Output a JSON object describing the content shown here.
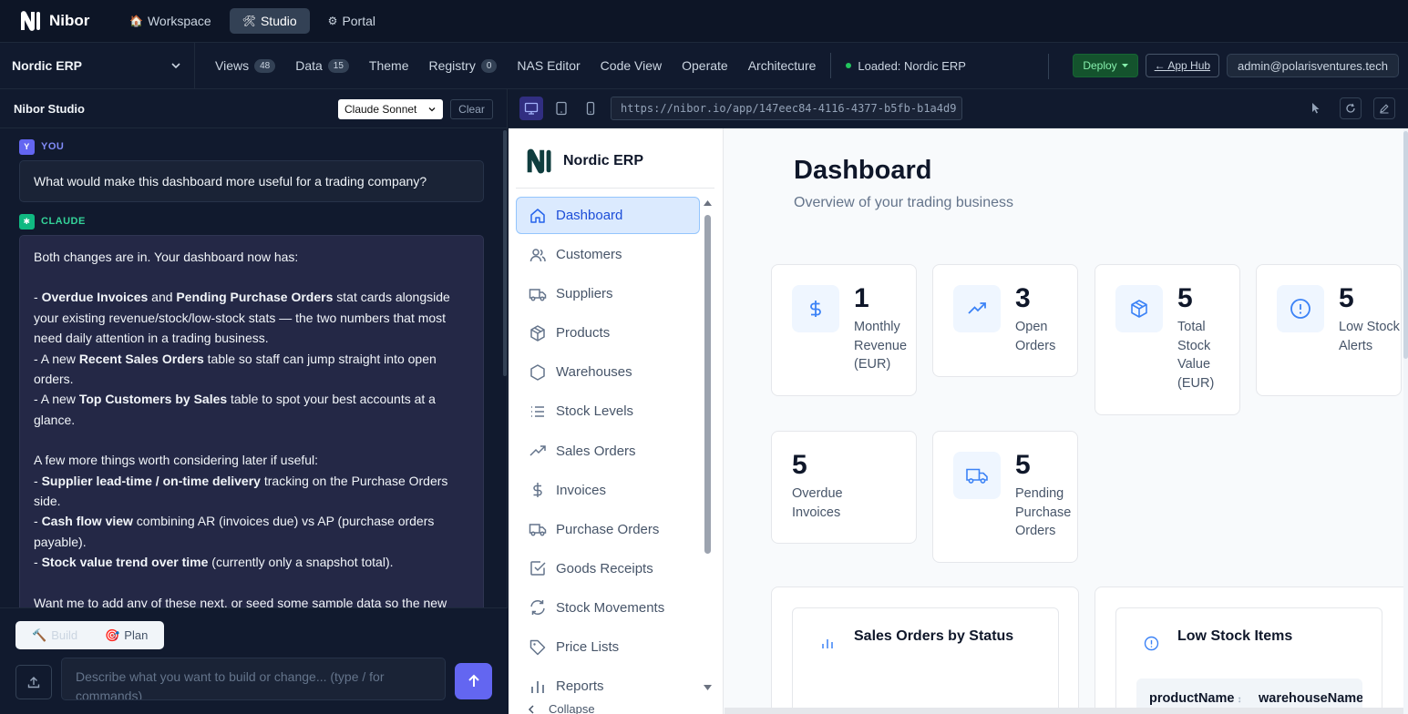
{
  "topbar": {
    "brand": "Nibor",
    "nav": [
      {
        "label": "Workspace",
        "emoji": "🏠"
      },
      {
        "label": "Studio",
        "emoji": "🛠"
      },
      {
        "label": "Portal",
        "emoji": "⚙"
      }
    ]
  },
  "subbar": {
    "project": "Nordic ERP",
    "tabs": [
      {
        "label": "Views",
        "badge": "48"
      },
      {
        "label": "Data",
        "badge": "15"
      },
      {
        "label": "Theme",
        "badge": ""
      },
      {
        "label": "Registry",
        "badge": "0"
      },
      {
        "label": "NAS Editor",
        "badge": ""
      },
      {
        "label": "Code View",
        "badge": ""
      },
      {
        "label": "Operate",
        "badge": ""
      },
      {
        "label": "Architecture",
        "badge": ""
      }
    ],
    "loaded": "Loaded: Nordic ERP",
    "deploy": "Deploy",
    "apphub": "← App Hub",
    "user": "admin@polarisventures.tech"
  },
  "chat": {
    "title": "Nibor Studio",
    "model": "Claude Sonnet",
    "clear": "Clear",
    "you_label": "YOU",
    "you_avatar": "Y",
    "claude_label": "CLAUDE",
    "claude_avatar": "✱",
    "user_message": "What would make this dashboard more useful for a trading company?",
    "ai": {
      "intro": "Both changes are in. Your dashboard now has:",
      "b1_pre": "- ",
      "b1_bold1": "Overdue Invoices",
      "b1_mid": " and ",
      "b1_bold2": "Pending Purchase Orders",
      "b1_post": " stat cards alongside your existing revenue/stock/low-stock stats — the two numbers that most need daily attention in a trading business.",
      "b2_pre": "- A new ",
      "b2_bold": "Recent Sales Orders",
      "b2_post": " table so staff can jump straight into open orders.",
      "b3_pre": "- A new ",
      "b3_bold": "Top Customers by Sales",
      "b3_post": " table to spot your best accounts at a glance.",
      "later": "A few more things worth considering later if useful:",
      "c1_pre": "- ",
      "c1_bold": "Supplier lead-time / on-time delivery",
      "c1_post": " tracking on the Purchase Orders side.",
      "c2_pre": "- ",
      "c2_bold": "Cash flow view",
      "c2_post": " combining AR (invoices due) vs AP (purchase orders payable).",
      "c3_pre": "- ",
      "c3_bold": "Stock value trend over time",
      "c3_post": " (currently only a snapshot total).",
      "closing": "Want me to add any of these next, or seed some sample data so the new"
    },
    "mode_build": "Build",
    "mode_build_emoji": "🔨",
    "mode_plan": "Plan",
    "mode_plan_emoji": "🎯",
    "prompt_placeholder": "Describe what you want to build or change... (type / for commands)"
  },
  "preview": {
    "url": "https://nibor.io/app/147eec84-4116-4377-b5fb-b1a4d9"
  },
  "app": {
    "brand": "Nordic ERP",
    "nav": [
      {
        "label": "Dashboard",
        "icon": "home-icon"
      },
      {
        "label": "Customers",
        "icon": "users-icon"
      },
      {
        "label": "Suppliers",
        "icon": "truck-icon"
      },
      {
        "label": "Products",
        "icon": "box-icon"
      },
      {
        "label": "Warehouses",
        "icon": "hexagon-icon"
      },
      {
        "label": "Stock Levels",
        "icon": "list-icon"
      },
      {
        "label": "Sales Orders",
        "icon": "trending-up-icon"
      },
      {
        "label": "Invoices",
        "icon": "dollar-icon"
      },
      {
        "label": "Purchase Orders",
        "icon": "truck-icon"
      },
      {
        "label": "Goods Receipts",
        "icon": "check-square-icon"
      },
      {
        "label": "Stock Movements",
        "icon": "refresh-icon"
      },
      {
        "label": "Price Lists",
        "icon": "tag-icon"
      },
      {
        "label": "Reports",
        "icon": "bar-chart-icon"
      }
    ],
    "collapse": "Collapse",
    "dashboard": {
      "title": "Dashboard",
      "subtitle": "Overview of your trading business",
      "stats": [
        {
          "value": "1",
          "label": "Monthly Revenue (EUR)",
          "icon": "dollar-icon"
        },
        {
          "value": "3",
          "label": "Open Orders",
          "icon": "trending-up-icon"
        },
        {
          "value": "5",
          "label": "Total Stock Value (EUR)",
          "icon": "box-icon"
        },
        {
          "value": "5",
          "label": "Low Stock Alerts",
          "icon": "alert-circle-icon"
        },
        {
          "value": "5",
          "label": "Overdue Invoices",
          "icon": ""
        },
        {
          "value": "5",
          "label": "Pending Purchase Orders",
          "icon": "truck-icon"
        }
      ],
      "sales_card_title": "Sales Orders by Status",
      "low_stock_title": "Low Stock Items",
      "low_stock_columns": [
        "productName",
        "warehouseName"
      ]
    }
  },
  "colors": {
    "accent": "#6366f1",
    "app_accent": "#3b82f6",
    "success": "#22c55e"
  }
}
